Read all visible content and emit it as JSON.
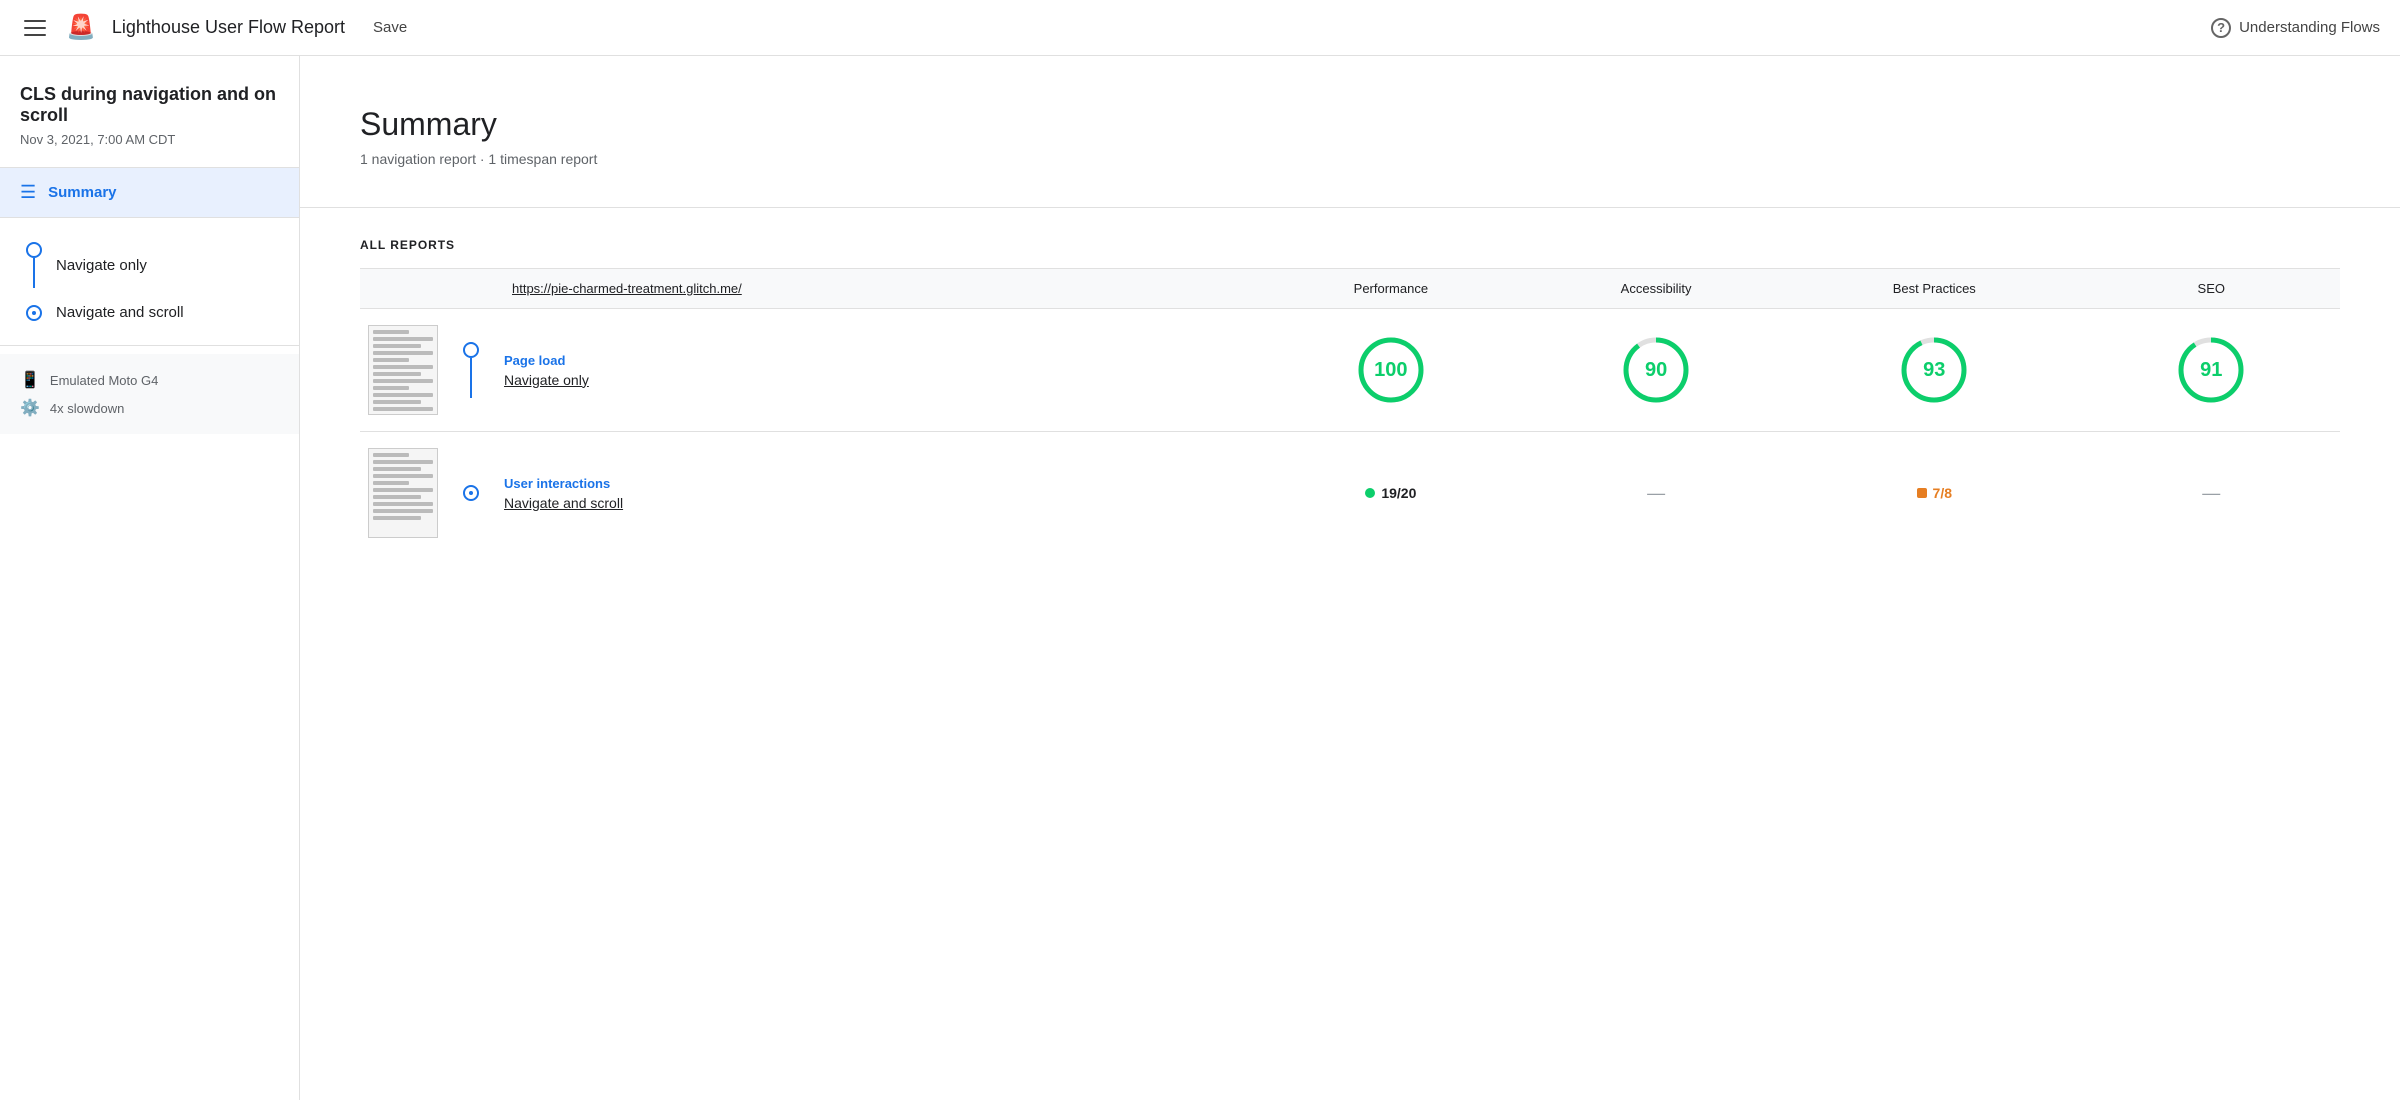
{
  "header": {
    "title": "Lighthouse User Flow Report",
    "save_label": "Save",
    "understanding_flows_label": "Understanding Flows"
  },
  "sidebar": {
    "project_title": "CLS during navigation and on scroll",
    "project_date": "Nov 3, 2021, 7:00 AM CDT",
    "summary_label": "Summary",
    "nav_items": [
      {
        "label": "Navigate only",
        "type": "circle"
      },
      {
        "label": "Navigate and scroll",
        "type": "clock"
      }
    ],
    "device_label": "Emulated Moto G4",
    "slowdown_label": "4x slowdown"
  },
  "main": {
    "summary_heading": "Summary",
    "summary_sub": "1 navigation report · 1 timespan report",
    "all_reports_label": "ALL REPORTS",
    "table_headers": {
      "url": "https://pie-charmed-treatment.glitch.me/",
      "performance": "Performance",
      "accessibility": "Accessibility",
      "best_practices": "Best Practices",
      "seo": "SEO"
    },
    "rows": [
      {
        "type": "Page load",
        "name": "Navigate only",
        "flow_icon": "circle",
        "performance": {
          "type": "circle",
          "value": 100,
          "color": "#0cce6b"
        },
        "accessibility": {
          "type": "circle",
          "value": 90,
          "color": "#0cce6b"
        },
        "best_practices": {
          "type": "circle",
          "value": 93,
          "color": "#0cce6b"
        },
        "seo": {
          "type": "circle",
          "value": 91,
          "color": "#0cce6b"
        }
      },
      {
        "type": "User interactions",
        "name": "Navigate and scroll",
        "flow_icon": "clock",
        "performance": {
          "type": "dot",
          "dot": "green",
          "value": "19/20"
        },
        "accessibility": {
          "type": "dash"
        },
        "best_practices": {
          "type": "dot",
          "dot": "orange",
          "value": "7/8"
        },
        "seo": {
          "type": "dash"
        }
      }
    ]
  }
}
